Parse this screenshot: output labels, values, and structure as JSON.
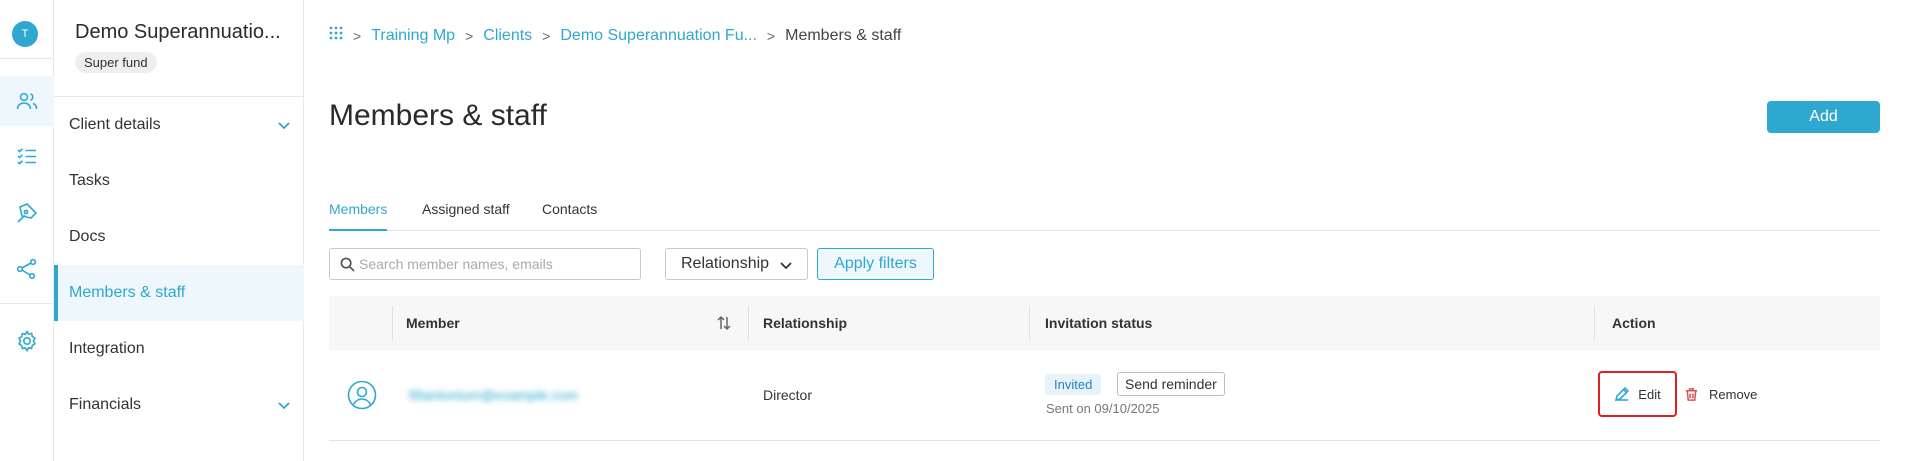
{
  "rail": {
    "avatar_initial": "T",
    "items": [
      {
        "icon": "users-icon"
      },
      {
        "icon": "tasks-icon"
      },
      {
        "icon": "pen-icon"
      },
      {
        "icon": "share-icon"
      },
      {
        "icon": "gear-icon"
      }
    ]
  },
  "client": {
    "name": "Demo Superannuatio...",
    "type_badge": "Super fund"
  },
  "subnav": {
    "items": [
      {
        "label": "Client details",
        "expandable": true
      },
      {
        "label": "Tasks"
      },
      {
        "label": "Docs"
      },
      {
        "label": "Members & staff",
        "active": true
      },
      {
        "label": "Integration"
      },
      {
        "label": "Financials",
        "expandable": true
      }
    ]
  },
  "breadcrumb": {
    "items": [
      "Training Mp",
      "Clients",
      "Demo Superannuation Fu..."
    ],
    "current": "Members & staff"
  },
  "page": {
    "title": "Members & staff",
    "add_label": "Add"
  },
  "tabs": [
    "Members",
    "Assigned staff",
    "Contacts"
  ],
  "filters": {
    "search_placeholder": "Search member names, emails",
    "relationship_label": "Relationship",
    "apply_label": "Apply filters"
  },
  "table": {
    "headers": {
      "member": "Member",
      "relationship": "Relationship",
      "invitation_status": "Invitation status",
      "action": "Action"
    },
    "rows": [
      {
        "email": "fifiantonium@example.com",
        "relationship": "Director",
        "status_badge": "Invited",
        "reminder_label": "Send reminder",
        "sent_on": "Sent on 09/10/2025",
        "edit_label": "Edit",
        "remove_label": "Remove"
      }
    ]
  },
  "colors": {
    "accent": "#2fa8cf",
    "highlight_border": "#e02020",
    "danger": "#d9534f"
  }
}
